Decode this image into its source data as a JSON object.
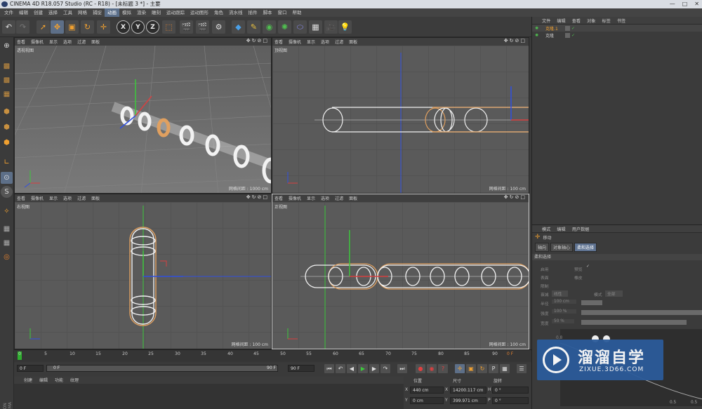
{
  "titlebar": {
    "title": "CINEMA 4D R18.057 Studio (RC - R18) - [未标题 3 *] - 主要",
    "min": "—",
    "max": "□",
    "close": "✕"
  },
  "menu": [
    "文件",
    "编辑",
    "创建",
    "选择",
    "工具",
    "网格",
    "捕捉",
    "动画",
    "模拟",
    "渲染",
    "雕刻",
    "运动跟踪",
    "运动图形",
    "角色",
    "流水线",
    "插件",
    "脚本",
    "窗口",
    "帮助"
  ],
  "menu_selected": "动画",
  "toolbar": {
    "axis_x": "X",
    "axis_y": "Y",
    "axis_z": "Z"
  },
  "viewports": {
    "perspective": {
      "menus": [
        "查看",
        "摄像机",
        "显示",
        "选项",
        "过滤",
        "面板"
      ],
      "label": "透视视图",
      "grid": "网格间距 : 1000 cm"
    },
    "top": {
      "menus": [
        "查看",
        "摄像机",
        "显示",
        "选项",
        "过滤",
        "面板"
      ],
      "label": "顶视图",
      "grid": "网格间距 : 100 cm"
    },
    "right": {
      "menus": [
        "查看",
        "摄像机",
        "显示",
        "选项",
        "过滤",
        "面板"
      ],
      "label": "右视图",
      "grid": "网格间距 : 100 cm"
    },
    "front": {
      "menus": [
        "查看",
        "摄像机",
        "显示",
        "选项",
        "过滤",
        "面板"
      ],
      "label": "正视图",
      "grid": "网格间距 : 100 cm"
    }
  },
  "objects": {
    "menus": [
      "文件",
      "编辑",
      "查看",
      "对象",
      "标签",
      "书签"
    ],
    "items": [
      {
        "name": "克隆.1"
      },
      {
        "name": "克隆"
      }
    ]
  },
  "attributes": {
    "menus": [
      "模式",
      "编辑",
      "用户数据"
    ],
    "tool": "移动",
    "tabs": [
      "轴向",
      "对象轴心",
      "柔和选择"
    ],
    "active_tab": "柔和选择",
    "section": "柔和选择",
    "rows": {
      "enable": "启用",
      "preview": "预览",
      "surface": "表面",
      "rubber": "橡皮",
      "restrict": "限制",
      "falloff": "衰减",
      "falloff_val": "线性",
      "mode": "模式",
      "mode_val": "全部",
      "radius": "半径",
      "radius_val": "100 cm",
      "strength": "强度",
      "strength_val": "100 %",
      "width": "宽度",
      "width_val": "50 %"
    },
    "graph_ticks": {
      "y": "0.8",
      "x1": "0.5",
      "x2": "0.5"
    }
  },
  "timeline": {
    "ticks": [
      "0",
      "5",
      "10",
      "15",
      "20",
      "25",
      "30",
      "35",
      "40",
      "45",
      "50",
      "55",
      "60",
      "65",
      "70",
      "75",
      "80",
      "85",
      "90"
    ],
    "frame_end": "0 F"
  },
  "playback": {
    "start": "0 F",
    "range_start": "0 F",
    "range_end": "90 F",
    "end": "90 F"
  },
  "materials": {
    "menus": [
      "创建",
      "编辑",
      "功能",
      "纹理"
    ]
  },
  "coords": {
    "headers": [
      "位置",
      "尺寸",
      "旋转"
    ],
    "rows": [
      {
        "axis": "X",
        "pos": "440 cm",
        "size": "14200.117 cm",
        "rot_axis": "H",
        "rot": "0 °"
      },
      {
        "axis": "Y",
        "pos": "0 cm",
        "size": "399.971 cm",
        "rot_axis": "P",
        "rot": "0 °"
      }
    ]
  },
  "watermark": {
    "title": "溜溜自学",
    "url": "ZIXUE.3D66.COM"
  },
  "side_label": "MAXON CINEMA 4D",
  "colors": {
    "accent": "#5b6f8a",
    "spline": "#ffffff",
    "selected": "#e0883a",
    "axis_x": "#d84040",
    "axis_y": "#3cc83c",
    "axis_z": "#3050e0"
  }
}
